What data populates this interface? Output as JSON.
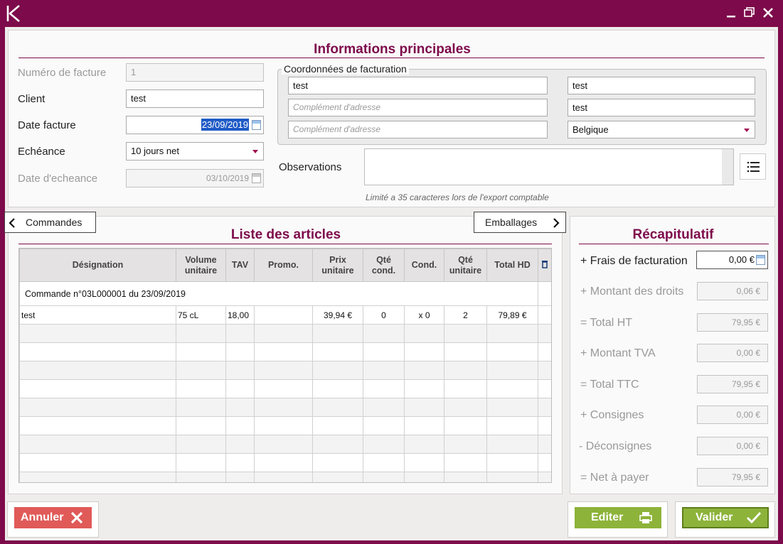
{
  "window": {
    "logo_letter": "K"
  },
  "main_info": {
    "title": "Informations principales",
    "invoice_number": {
      "label": "Numéro de facture",
      "value": "1"
    },
    "client": {
      "label": "Client",
      "value": "test"
    },
    "invoice_date": {
      "label": "Date facture",
      "value": "23/09/2019"
    },
    "terms": {
      "label": "Echéance",
      "value": "10 jours net"
    },
    "due_date": {
      "label": "Date d'echeance",
      "value": "03/10/2019"
    }
  },
  "billing": {
    "legend": "Coordonnées de facturation",
    "address1": "test",
    "address2_placeholder": "Complément d'adresse",
    "address3_placeholder": "Complément d'adresse",
    "postcode": "test",
    "city": "test",
    "country": "Belgique"
  },
  "observations": {
    "label": "Observations",
    "hint": "Limité a 35 caracteres lors de l'export comptable",
    "value": ""
  },
  "articles": {
    "prev_tab": "Commandes",
    "next_tab": "Emballages",
    "title": "Liste des articles",
    "headers": {
      "designation": "Désignation",
      "volume_1": "Volume",
      "volume_2": "unitaire",
      "tav": "TAV",
      "promo": "Promo.",
      "price_1": "Prix",
      "price_2": "unitaire",
      "qty_cond_1": "Qté",
      "qty_cond_2": "cond.",
      "cond": "Cond.",
      "qty_unit_1": "Qté",
      "qty_unit_2": "unitaire",
      "total": "Total HD"
    },
    "order_line": "Commande n°03L000001 du 23/09/2019",
    "rows": [
      {
        "designation": "test",
        "volume": "75 cL",
        "tav": "18,00",
        "promo": "",
        "price": "39,94 €",
        "qty_cond": "0",
        "cond": "x 0",
        "qty_unit": "2",
        "total": "79,89 €"
      }
    ]
  },
  "recap": {
    "title": "Récapitulatif",
    "items": [
      {
        "label": "+ Frais de facturation",
        "value": "0,00 €"
      },
      {
        "label": "+ Montant des droits",
        "value": "0,06 €"
      },
      {
        "label": "= Total HT",
        "value": "79,95 €"
      },
      {
        "label": "+ Montant TVA",
        "value": "0,00 €"
      },
      {
        "label": "= Total TTC",
        "value": "79,95 €"
      },
      {
        "label": "+ Consignes",
        "value": "0,00 €"
      },
      {
        "label": "- Déconsignes",
        "value": "0,00 €"
      },
      {
        "label": "= Net à payer",
        "value": "79,95 €"
      }
    ]
  },
  "buttons": {
    "cancel": "Annuler",
    "edit": "Editer",
    "validate": "Valider"
  },
  "colors": {
    "brand": "#7d0a4b",
    "cancel": "#e05a58",
    "action_green": "#8db33a"
  }
}
